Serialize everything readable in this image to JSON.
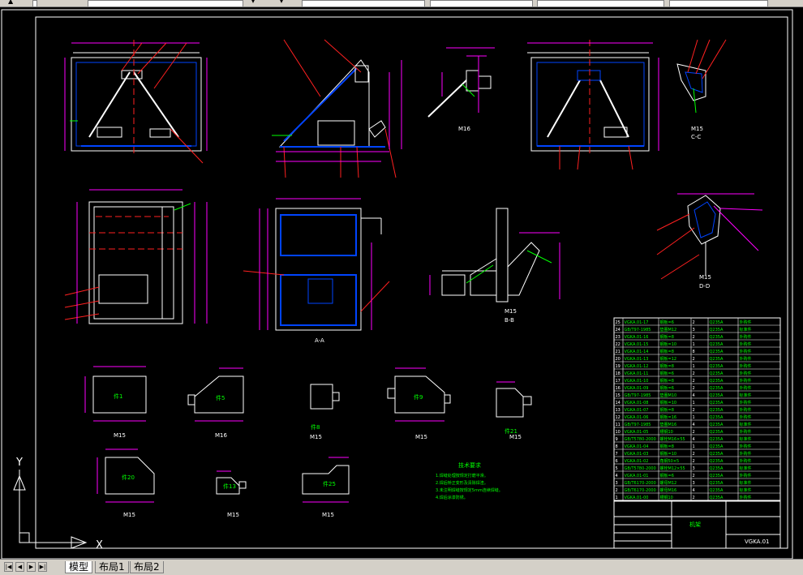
{
  "app": {
    "title_fragment": ""
  },
  "tabs": [
    {
      "label": "模型",
      "active": true
    },
    {
      "label": "布局1",
      "active": false
    },
    {
      "label": "布局2",
      "active": false
    }
  ],
  "nav_buttons": [
    "first",
    "prev",
    "next",
    "last"
  ],
  "ucs": {
    "x_label": "X",
    "y_label": "Y"
  },
  "views": {
    "scale_m15": "M15",
    "section_aa": "A-A",
    "section_bb": "B-B",
    "section_cc": "C-C",
    "section_dd": "D-D",
    "m16": "M16",
    "m16b": "M16"
  },
  "parts": [
    "件1",
    "件5",
    "件8",
    "件9",
    "件21",
    "件20",
    "件13",
    "件25"
  ],
  "notes": {
    "title": "技术要求",
    "lines": [
      "1.焊缝处理按规定打磨平滑。",
      "2.焊后矫正变形及清除焊渣。",
      "3.未注明焊缝按规定5mm连续焊缝。",
      "4.焊后涂漆防锈。"
    ]
  },
  "title_block": {
    "drawing_no": "VGKA.01",
    "name": "机架"
  },
  "bom_rows": [
    [
      "25",
      "VGKA.01-17",
      "钢板=6",
      "2",
      "Q235A",
      "外购件"
    ],
    [
      "24",
      "GB/T97-1985",
      "垫圈M12",
      "3",
      "Q235A",
      "标准件"
    ],
    [
      "23",
      "VGKA.01-16",
      "钢板=8",
      "2",
      "Q235A",
      "外购件"
    ],
    [
      "22",
      "VGKA.01-15",
      "钢板=10",
      "1",
      "Q235A",
      "外购件"
    ],
    [
      "21",
      "VGKA.01-14",
      "钢板=8",
      "8",
      "Q235A",
      "外购件"
    ],
    [
      "20",
      "VGKA.01-13",
      "钢板=12",
      "2",
      "Q235A",
      "外购件"
    ],
    [
      "19",
      "VGKA.01-12",
      "钢板=8",
      "1",
      "Q235A",
      "外购件"
    ],
    [
      "18",
      "VGKA.01-11",
      "钢板=6",
      "2",
      "Q235A",
      "外购件"
    ],
    [
      "17",
      "VGKA.01-10",
      "钢板=8",
      "2",
      "Q235A",
      "外购件"
    ],
    [
      "16",
      "VGKA.01-09",
      "钢板=6",
      "2",
      "Q235A",
      "外购件"
    ],
    [
      "15",
      "GB/T97-1985",
      "垫圈M10",
      "4",
      "Q235A",
      "标准件"
    ],
    [
      "14",
      "VGKA.01-08",
      "钢板=10",
      "1",
      "Q235A",
      "外购件"
    ],
    [
      "13",
      "VGKA.01-07",
      "钢板=8",
      "2",
      "Q235A",
      "外购件"
    ],
    [
      "12",
      "VGKA.01-06",
      "钢板=16",
      "1",
      "Q235A",
      "外购件"
    ],
    [
      "11",
      "GB/T97-1985",
      "垫圈M16",
      "4",
      "Q235A",
      "标准件"
    ],
    [
      "10",
      "VGKA.01-05",
      "槽钢10",
      "2",
      "Q235A",
      "外购件"
    ],
    [
      "9",
      "GB/T5780-2000",
      "螺栓M16×55",
      "4",
      "Q235A",
      "标准件"
    ],
    [
      "8",
      "VGKA.01-04",
      "钢板=8",
      "1",
      "Q235A",
      "外购件"
    ],
    [
      "7",
      "VGKA.01-03",
      "钢板=10",
      "2",
      "Q235A",
      "外购件"
    ],
    [
      "6",
      "VGKA.01-02",
      "角钢50×5",
      "2",
      "Q235A",
      "外购件"
    ],
    [
      "5",
      "GB/T5780-2000",
      "螺栓M12×55",
      "3",
      "Q235A",
      "标准件"
    ],
    [
      "4",
      "VGKA.01-01",
      "钢板=6",
      "2",
      "Q235A",
      "外购件"
    ],
    [
      "3",
      "GB/T6170-2000",
      "螺母M12",
      "3",
      "Q235A",
      "标准件"
    ],
    [
      "2",
      "GB/T6170-2000",
      "螺母M16",
      "4",
      "Q235A",
      "标准件"
    ],
    [
      "1",
      "VGKA.01-00",
      "槽钢10",
      "2",
      "Q235A",
      "外购件"
    ]
  ]
}
